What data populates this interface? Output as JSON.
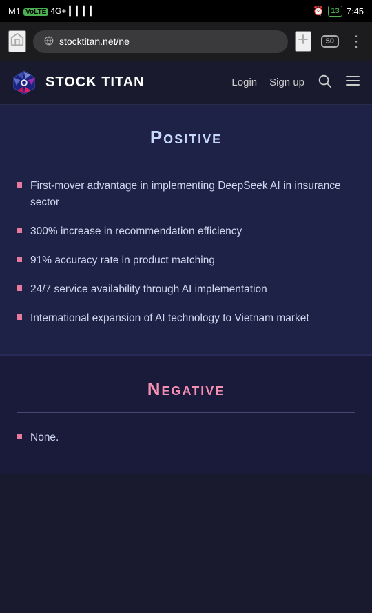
{
  "statusBar": {
    "carrier": "M1",
    "networkType": "VoLTE 4G+",
    "time": "7:45",
    "batteryLevel": "13",
    "alarmIcon": "⏰"
  },
  "browserBar": {
    "url": "stocktitan.net/ne",
    "tabsCount": "50",
    "homeBtnLabel": "🏠",
    "addBtnLabel": "+",
    "menuBtnLabel": "⋮"
  },
  "navHeader": {
    "brandName": "STOCK TITAN",
    "loginLabel": "Login",
    "signupLabel": "Sign up"
  },
  "positiveSection": {
    "title": "Positive",
    "divider": true,
    "bullets": [
      "First-mover advantage in implementing DeepSeek AI in insurance sector",
      "300% increase in recommendation efficiency",
      "91% accuracy rate in product matching",
      "24/7 service availability through AI implementation",
      "International expansion of AI technology to Vietnam market"
    ]
  },
  "negativeSection": {
    "title": "Negative",
    "divider": true,
    "bullets": [
      "None."
    ]
  }
}
